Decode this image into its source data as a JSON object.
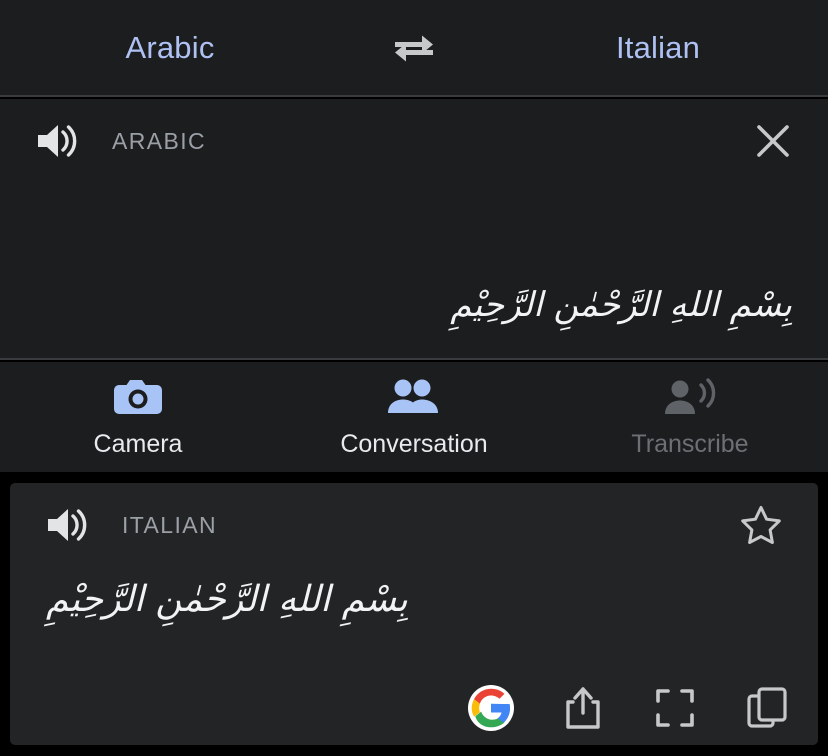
{
  "colors": {
    "background": "#000000",
    "panel": "#1c1d1f",
    "card": "#232426",
    "divider": "#3a3b3e",
    "accent_blue": "#aec1f2",
    "label_gray": "#9aa0a6",
    "text_white": "#f1f3f4",
    "disabled_gray": "#6c6f73",
    "google_red": "#ea4335",
    "google_yellow": "#fbbc05",
    "google_green": "#34a853",
    "google_blue": "#4285f4"
  },
  "language_bar": {
    "source_language": "Arabic",
    "target_language": "Italian",
    "swap_icon": "swap-horizontal-icon"
  },
  "source_panel": {
    "speaker_icon": "speaker-volume-icon",
    "language_label": "ARABIC",
    "close_icon": "close-icon",
    "detected_text": "بِسْمِ اللهِ الرَّحْمٰنِ الرَّحِيْمِ",
    "input_text": "بِسْمِ اللهِ الرَّحْمٰنِ الرَّحِيْمِ"
  },
  "actions": [
    {
      "label": "Camera",
      "icon": "camera-icon",
      "disabled": false
    },
    {
      "label": "Conversation",
      "icon": "people-icon",
      "disabled": false
    },
    {
      "label": "Transcribe",
      "icon": "transcribe-icon",
      "disabled": true
    }
  ],
  "result_card": {
    "speaker_icon": "speaker-volume-icon",
    "language_label": "ITALIAN",
    "star_icon": "star-outline-icon",
    "translated_text": "بِسْمِ اللهِ الرَّحْمٰنِ الرَّحِيْمِ",
    "toolbar": [
      {
        "icon": "google-logo-icon",
        "name": "google-search-button"
      },
      {
        "icon": "share-icon",
        "name": "share-button"
      },
      {
        "icon": "fullscreen-icon",
        "name": "fullscreen-button"
      },
      {
        "icon": "copy-icon",
        "name": "copy-button"
      }
    ]
  }
}
